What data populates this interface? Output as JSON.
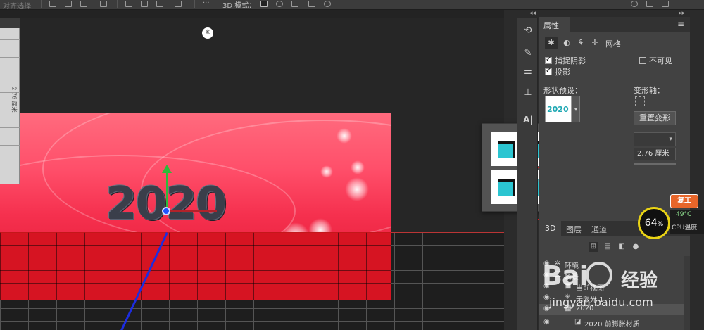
{
  "optbar": {
    "mode_label": "3D 模式：",
    "faded_left": "对齐选择"
  },
  "canvas": {
    "ruler_text": "2.76 厘米",
    "object_text": "2020"
  },
  "preset_popup": {
    "thumbnails": [
      "cube-preset-1",
      "cube-preset-2",
      "cube-preset-3",
      "cube-preset-4",
      "cube-preset-5",
      "cube-preset-6"
    ],
    "selected_index": 4,
    "selection_color": "#e0191f"
  },
  "properties": {
    "tab_title": "属性",
    "icon_tab_mesh": "网格",
    "catch_shadow": "捕捉阴影",
    "cast_shadow": "投影",
    "invisible": "不可见",
    "shape_preset": "形状预设：",
    "preset_thumb_text": "2020",
    "deform_axis": "变形轴：",
    "reset_deform": "重置变形",
    "depth_value": "2.76 厘米"
  },
  "panel3d": {
    "tabs": [
      "3D",
      "图层",
      "通道"
    ],
    "rows": [
      {
        "name": "环境",
        "icon": "environment-icon"
      },
      {
        "name": "场景",
        "icon": "scene-icon"
      },
      {
        "name": "当前视图",
        "icon": "camera-icon"
      },
      {
        "name": "无限光 1",
        "icon": "light-icon"
      },
      {
        "name": "2020",
        "icon": "mesh-icon"
      },
      {
        "name": "2020 前膨胀材质",
        "icon": "material-icon"
      }
    ]
  },
  "cpu": {
    "percent": "64",
    "percent_unit": "%",
    "temp": "49°C",
    "label": "CPU温度",
    "badge": "复工"
  },
  "watermark": {
    "brand": "Bai",
    "brand_cn": "经验",
    "url": "jingyan.baidu.com"
  },
  "colors": {
    "accent_cyan": "#2bc5d1",
    "banner_red": "#f5304e",
    "cpu_ring": "#e9d315"
  }
}
